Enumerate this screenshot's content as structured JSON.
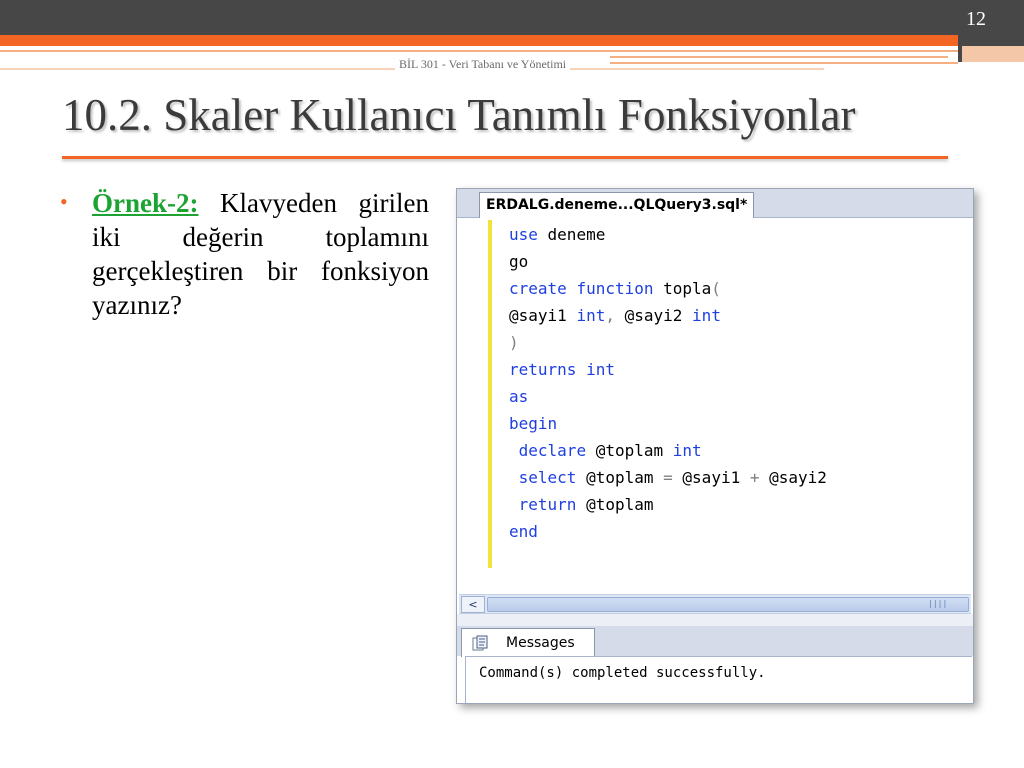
{
  "header": {
    "page_number": "12",
    "course": "BİL 301 - Veri Tabanı ve Yönetimi"
  },
  "slide": {
    "title": "10.2. Skaler Kullanıcı Tanımlı Fonksiyonlar",
    "bullet": {
      "label": "Örnek-2:",
      "text": " Klavyeden girilen iki değerin toplamını gerçekleştiren bir fonksiyon yazınız?"
    }
  },
  "editor": {
    "tab_title": "ERDALG.deneme...QLQuery3.sql*",
    "lines": [
      [
        {
          "t": "use",
          "c": "kw"
        },
        {
          "t": " deneme",
          "c": "tx"
        }
      ],
      [
        {
          "t": "go",
          "c": "tx"
        }
      ],
      [
        {
          "t": "create",
          "c": "kw"
        },
        {
          "t": " ",
          "c": "tx"
        },
        {
          "t": "function",
          "c": "kw"
        },
        {
          "t": " topla",
          "c": "tx"
        },
        {
          "t": "(",
          "c": "pn"
        }
      ],
      [
        {
          "t": "@sayi1 ",
          "c": "tx"
        },
        {
          "t": "int",
          "c": "kw"
        },
        {
          "t": ", ",
          "c": "pn"
        },
        {
          "t": "@sayi2 ",
          "c": "tx"
        },
        {
          "t": "int",
          "c": "kw"
        }
      ],
      [
        {
          "t": ")",
          "c": "pn"
        }
      ],
      [
        {
          "t": "returns",
          "c": "kw"
        },
        {
          "t": " ",
          "c": "tx"
        },
        {
          "t": "int",
          "c": "kw"
        }
      ],
      [
        {
          "t": "as",
          "c": "kw"
        }
      ],
      [
        {
          "t": "begin",
          "c": "kw"
        }
      ],
      [
        {
          "t": " ",
          "c": "tx"
        },
        {
          "t": "declare",
          "c": "kw"
        },
        {
          "t": " @toplam ",
          "c": "tx"
        },
        {
          "t": "int",
          "c": "kw"
        }
      ],
      [
        {
          "t": " ",
          "c": "tx"
        },
        {
          "t": "select",
          "c": "kw"
        },
        {
          "t": " @toplam ",
          "c": "tx"
        },
        {
          "t": "=",
          "c": "pn"
        },
        {
          "t": " @sayi1 ",
          "c": "tx"
        },
        {
          "t": "+",
          "c": "pn"
        },
        {
          "t": " @sayi2",
          "c": "tx"
        }
      ],
      [
        {
          "t": " ",
          "c": "tx"
        },
        {
          "t": "return",
          "c": "kw"
        },
        {
          "t": " @toplam",
          "c": "tx"
        }
      ],
      [
        {
          "t": "end",
          "c": "kw"
        }
      ]
    ],
    "scroll_left_glyph": "<",
    "scroll_grip": "||||"
  },
  "messages": {
    "tab_label": "Messages",
    "text": "Command(s) completed successfully."
  },
  "icons": {
    "bullet": "•",
    "messages_icon": "messages-icon"
  },
  "colors": {
    "accent": "#f26522",
    "example_label": "#1ba333",
    "keyword": "#1f3fe0"
  }
}
